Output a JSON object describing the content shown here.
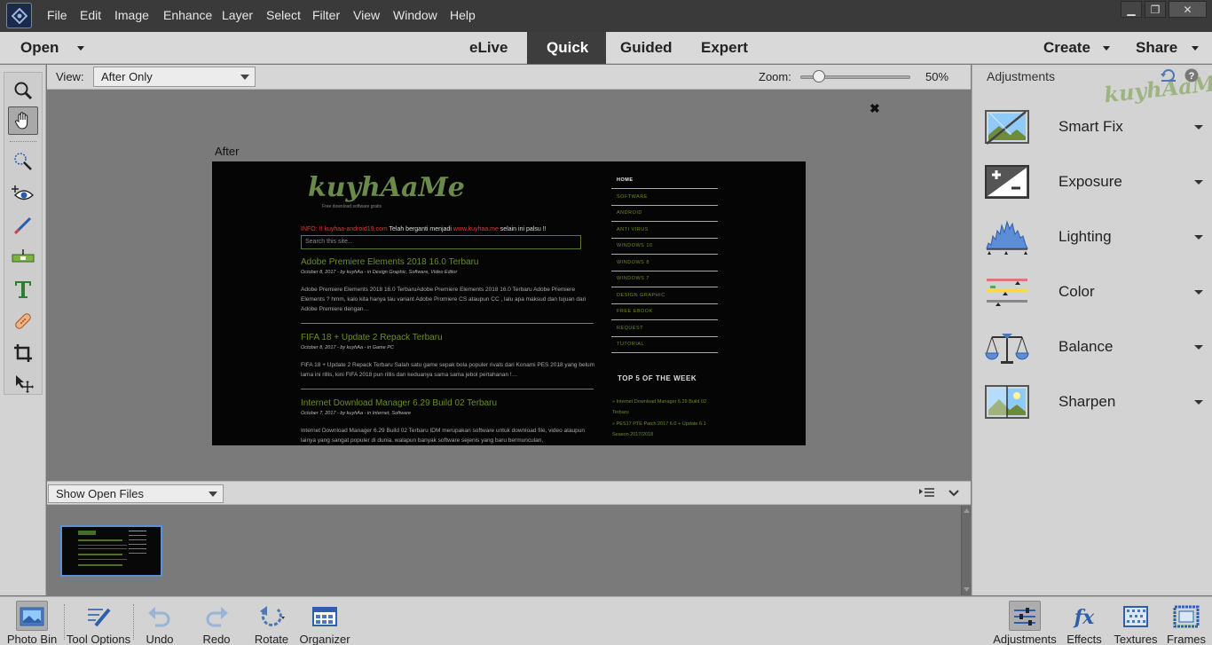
{
  "menubar": {
    "items": [
      "File",
      "Edit",
      "Image",
      "Enhance",
      "Layer",
      "Select",
      "Filter",
      "View",
      "Window",
      "Help"
    ],
    "window_controls": {
      "minimize": "▁",
      "restore": "❐",
      "close": "✕"
    }
  },
  "modebar": {
    "open": "Open",
    "tabs": [
      "eLive",
      "Quick",
      "Guided",
      "Expert"
    ],
    "active_tab": "Quick",
    "create": "Create",
    "share": "Share"
  },
  "tools": [
    {
      "name": "zoom-tool",
      "icon": "magnifier-icon"
    },
    {
      "name": "hand-tool",
      "icon": "hand-icon",
      "active": true
    },
    {
      "name": "quick-selection-tool",
      "icon": "quick-selection-icon"
    },
    {
      "name": "red-eye-tool",
      "icon": "eye-icon"
    },
    {
      "name": "whiten-teeth-tool",
      "icon": "brush-icon"
    },
    {
      "name": "straighten-tool",
      "icon": "level-icon"
    },
    {
      "name": "type-tool",
      "icon": "type-icon"
    },
    {
      "name": "spot-healing-tool",
      "icon": "bandage-icon"
    },
    {
      "name": "crop-tool",
      "icon": "crop-icon"
    },
    {
      "name": "move-tool",
      "icon": "move-icon"
    }
  ],
  "viewbar": {
    "view_label": "View:",
    "view_value": "After Only",
    "zoom_label": "Zoom:",
    "zoom_value": "50%",
    "zoom_fraction": 0.17
  },
  "canvas": {
    "after_label": "After",
    "close_glyph": "✖",
    "preview": {
      "logo": "kuyhAaMe",
      "tagline": "Free download software gratis",
      "notice_prefix": "INFO: !! ",
      "notice_old": "kuyhaa-android19.com",
      "notice_mid": " Telah berganti menjadi ",
      "notice_new": "www.kuyhaa.me",
      "notice_suffix": " selain ini palsu !!",
      "search_placeholder": "Search this site...",
      "posts": [
        {
          "title": "Adobe Premiere Elements 2018 16.0 Terbaru",
          "meta": "October 8, 2017 - by kuyhAa - in Design Graphic, Software, Video Editor",
          "excerpt": "Adobe Premiere Elements 2018 16.0 TerbaruAdobe Premiere Elements 2018 16.0 Terbaru Adobe Premiere Elements ? hmm, kalo kita hanya tau variant Adobe Promiere CS ataupun CC , lalu apa maksud dan tujuan dari Adobe Premiere dengan…"
        },
        {
          "title": "FIFA 18 + Update 2 Repack Terbaru",
          "meta": "October 8, 2017 - by kuyhAa - in Game PC",
          "excerpt": "FIFA 18 + Update 2 Repack Terbaru Salah satu game sepak bola populer rivals dari Konami PES 2018 yang belum lama ini rillis, kini FIFA 2018 pun rillis dan keduanya sama sama jebol pertahanan !…"
        },
        {
          "title": "Internet Download Manager 6.29 Build 02 Terbaru",
          "meta": "October 7, 2017 - by kuyhAa - in Internet, Software",
          "excerpt": "Internet Download Manager 6.29 Build 02 Terbaru IDM merupakan software untuk download file, video ataupun lainya yang sangat populer di dunia. walapun banyak software sejenis yang baru bermunculan,"
        }
      ],
      "nav": [
        "HOME",
        "SOFTWARE",
        "ANDROID",
        "ANTI VIRUS",
        "WINDOWS 10",
        "WINDOWS 8",
        "WINDOWS 7",
        "DESIGN GRAPHIC",
        "FREE EBOOK",
        "REQUEST",
        "TUTORIAL"
      ],
      "side_heading": "TOP 5 OF THE WEEK",
      "side_items": [
        "Internet Download Manager 6.29 Build 02 Terbaru",
        "PES17 PTE Patch 2017 6.0 + Update 6.1 Season 2017/2018"
      ]
    }
  },
  "bin": {
    "select_value": "Show Open Files"
  },
  "adjustments": {
    "title": "Adjustments",
    "watermark": "kuyhAaMe",
    "items": [
      {
        "label": "Smart Fix",
        "icon": "smart-fix-icon"
      },
      {
        "label": "Exposure",
        "icon": "exposure-icon"
      },
      {
        "label": "Lighting",
        "icon": "histogram-icon"
      },
      {
        "label": "Color",
        "icon": "color-sliders-icon"
      },
      {
        "label": "Balance",
        "icon": "scale-icon"
      },
      {
        "label": "Sharpen",
        "icon": "sharpen-icon"
      }
    ]
  },
  "taskbar": {
    "left": [
      "Photo Bin",
      "Tool Options",
      "Undo",
      "Redo",
      "Rotate",
      "Organizer"
    ],
    "right": [
      "Adjustments",
      "Effects",
      "Textures",
      "Frames"
    ]
  },
  "colors": {
    "menubar": "#3a3a3a",
    "panel": "#d3d3d3",
    "canvas": "#7a7a7a",
    "accent_link": "#6b8e23",
    "active_tab": "#3d3d3d",
    "selection": "#5b8fd6"
  }
}
